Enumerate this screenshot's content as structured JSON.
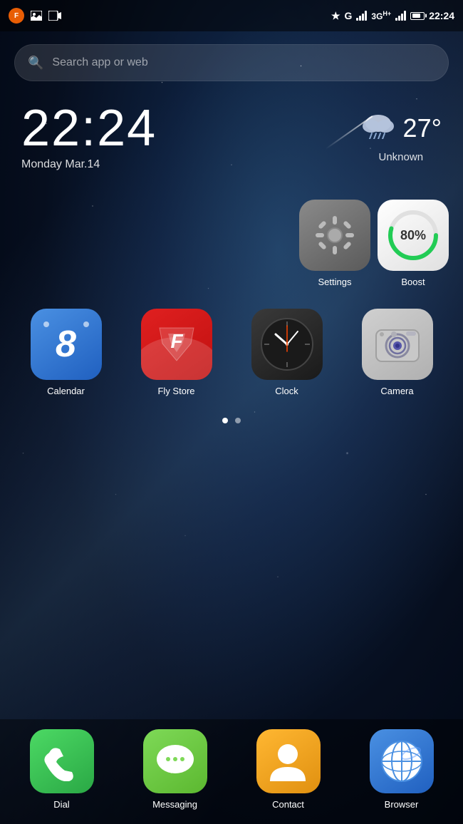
{
  "statusBar": {
    "time": "22:24",
    "network": "G",
    "networkType": "3G",
    "networkPlus": "H+",
    "batteryPercent": 75
  },
  "search": {
    "placeholder": "Search app or web"
  },
  "clock": {
    "time": "22:24",
    "date": "Monday Mar.14"
  },
  "weather": {
    "temp": "27°",
    "location": "Unknown"
  },
  "topApps": [
    {
      "id": "settings",
      "label": "Settings"
    },
    {
      "id": "boost",
      "label": "Boost",
      "percent": "80%"
    }
  ],
  "apps": [
    {
      "id": "calendar",
      "label": "Calendar"
    },
    {
      "id": "flystore",
      "label": "Fly Store"
    },
    {
      "id": "clock",
      "label": "Clock"
    },
    {
      "id": "camera",
      "label": "Camera"
    }
  ],
  "dock": [
    {
      "id": "dial",
      "label": "Dial"
    },
    {
      "id": "messaging",
      "label": "Messaging"
    },
    {
      "id": "contact",
      "label": "Contact"
    },
    {
      "id": "browser",
      "label": "Browser"
    }
  ],
  "dots": [
    true,
    false
  ]
}
